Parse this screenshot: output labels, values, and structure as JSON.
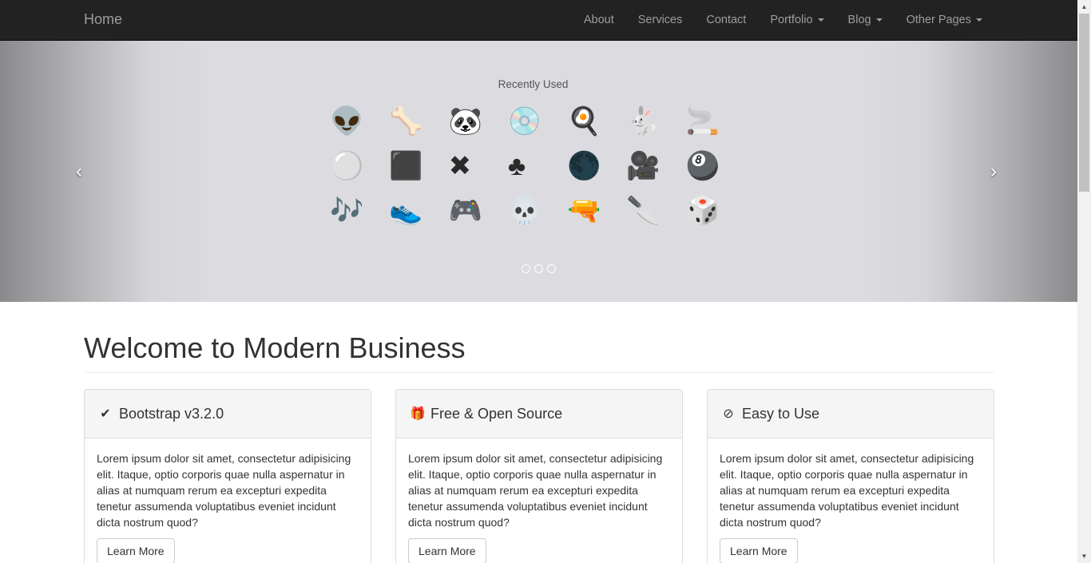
{
  "navbar": {
    "brand": "Home",
    "items": [
      {
        "label": "About",
        "dropdown": false
      },
      {
        "label": "Services",
        "dropdown": false
      },
      {
        "label": "Contact",
        "dropdown": false
      },
      {
        "label": "Portfolio",
        "dropdown": true
      },
      {
        "label": "Blog",
        "dropdown": true
      },
      {
        "label": "Other Pages",
        "dropdown": true
      }
    ]
  },
  "carousel": {
    "slide_title": "Recently Used",
    "rows": [
      [
        "👽",
        "🦴",
        "🐼",
        "💿",
        "🍳",
        "🐇",
        "🚬"
      ],
      [
        "⚪",
        "⬛",
        "✖",
        "♣",
        "🌑",
        "🎥",
        "🎱"
      ],
      [
        "🎶",
        "👟",
        "🎮",
        "💀",
        "🔫",
        "🔪",
        "🎲"
      ]
    ],
    "prev_glyph": "‹",
    "next_glyph": "›",
    "indicator_count": 3
  },
  "main": {
    "title": "Welcome to Modern Business",
    "panels": [
      {
        "icon": "check-icon",
        "icon_glyph": "✔",
        "title": "Bootstrap v3.2.0",
        "body": "Lorem ipsum dolor sit amet, consectetur adipisicing elit. Itaque, optio corporis quae nulla aspernatur in alias at numquam rerum ea excepturi expedita tenetur assumenda voluptatibus eveniet incidunt dicta nostrum quod?",
        "button": "Learn More"
      },
      {
        "icon": "gift-icon",
        "icon_glyph": "🎁",
        "title": "Free & Open Source",
        "body": "Lorem ipsum dolor sit amet, consectetur adipisicing elit. Itaque, optio corporis quae nulla aspernatur in alias at numquam rerum ea excepturi expedita tenetur assumenda voluptatibus eveniet incidunt dicta nostrum quod?",
        "button": "Learn More"
      },
      {
        "icon": "compass-icon",
        "icon_glyph": "⊘",
        "title": "Easy to Use",
        "body": "Lorem ipsum dolor sit amet, consectetur adipisicing elit. Itaque, optio corporis quae nulla aspernatur in alias at numquam rerum ea excepturi expedita tenetur assumenda voluptatibus eveniet incidunt dicta nostrum quod?",
        "button": "Learn More"
      }
    ]
  },
  "colors": {
    "navbar_bg": "#222222",
    "nav_text": "#9d9d9d",
    "panel_heading_bg": "#f5f5f5"
  }
}
